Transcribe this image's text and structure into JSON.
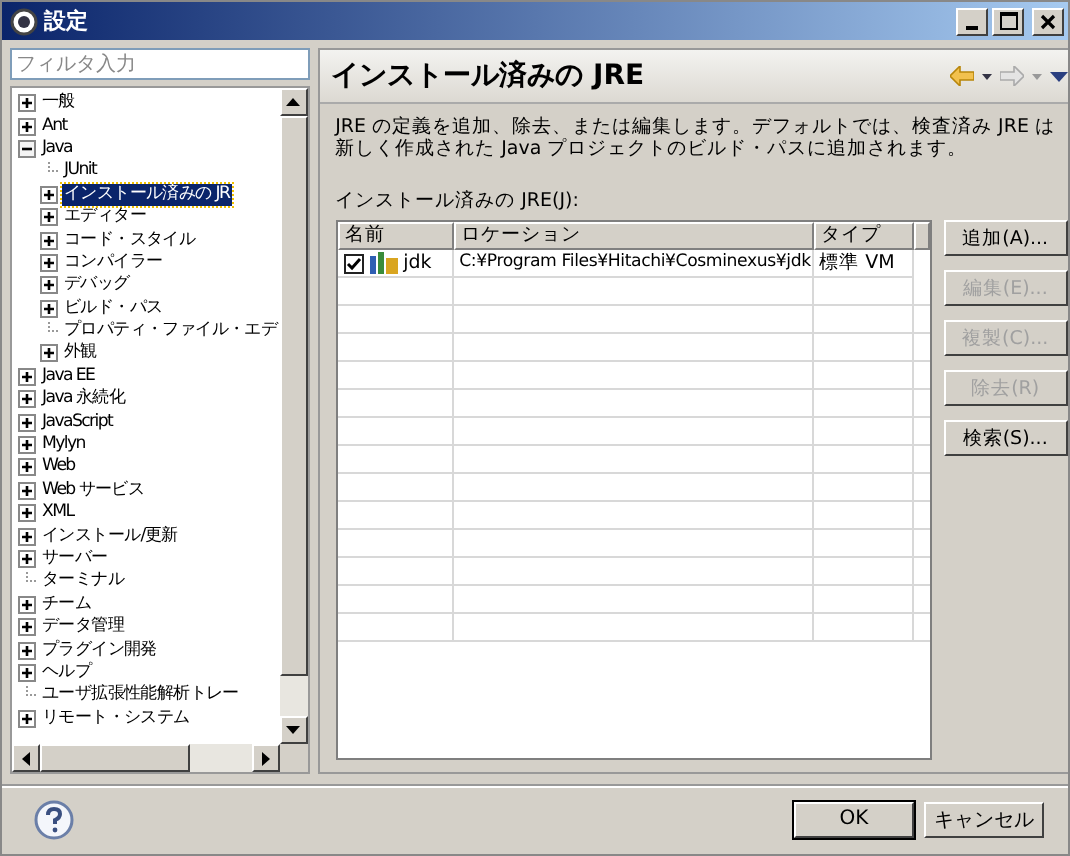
{
  "window": {
    "title": "設定"
  },
  "filter": {
    "placeholder": "フィルタ入力"
  },
  "tree": [
    {
      "label": "一般",
      "expanded": false,
      "expandable": true,
      "selected": false
    },
    {
      "label": "Ant",
      "expanded": false,
      "expandable": true,
      "selected": false
    },
    {
      "label": "Java",
      "expanded": true,
      "expandable": true,
      "selected": false,
      "children": [
        {
          "label": "JUnit",
          "expandable": false,
          "selected": false
        },
        {
          "label": "インストール済みの JR",
          "expanded": false,
          "expandable": true,
          "selected": true
        },
        {
          "label": "エディター",
          "expanded": false,
          "expandable": true,
          "selected": false
        },
        {
          "label": "コード・スタイル",
          "expanded": false,
          "expandable": true,
          "selected": false
        },
        {
          "label": "コンパイラー",
          "expanded": false,
          "expandable": true,
          "selected": false
        },
        {
          "label": "デバッグ",
          "expanded": false,
          "expandable": true,
          "selected": false
        },
        {
          "label": "ビルド・パス",
          "expanded": false,
          "expandable": true,
          "selected": false
        },
        {
          "label": "プロパティ・ファイル・エデ",
          "expandable": false,
          "selected": false
        },
        {
          "label": "外観",
          "expanded": false,
          "expandable": true,
          "selected": false
        }
      ]
    },
    {
      "label": "Java EE",
      "expanded": false,
      "expandable": true,
      "selected": false
    },
    {
      "label": "Java 永続化",
      "expanded": false,
      "expandable": true,
      "selected": false
    },
    {
      "label": "JavaScript",
      "expanded": false,
      "expandable": true,
      "selected": false
    },
    {
      "label": "Mylyn",
      "expanded": false,
      "expandable": true,
      "selected": false
    },
    {
      "label": "Web",
      "expanded": false,
      "expandable": true,
      "selected": false
    },
    {
      "label": "Web サービス",
      "expanded": false,
      "expandable": true,
      "selected": false
    },
    {
      "label": "XML",
      "expanded": false,
      "expandable": true,
      "selected": false
    },
    {
      "label": "インストール/更新",
      "expanded": false,
      "expandable": true,
      "selected": false
    },
    {
      "label": "サーバー",
      "expanded": false,
      "expandable": true,
      "selected": false
    },
    {
      "label": "ターミナル",
      "expandable": false,
      "selected": false
    },
    {
      "label": "チーム",
      "expanded": false,
      "expandable": true,
      "selected": false
    },
    {
      "label": "データ管理",
      "expanded": false,
      "expandable": true,
      "selected": false
    },
    {
      "label": "プラグイン開発",
      "expanded": false,
      "expandable": true,
      "selected": false
    },
    {
      "label": "ヘルプ",
      "expanded": false,
      "expandable": true,
      "selected": false
    },
    {
      "label": "ユーザ拡張性能解析トレー",
      "expandable": false,
      "selected": false
    },
    {
      "label": "リモート・システム",
      "expanded": false,
      "expandable": true,
      "selected": false
    }
  ],
  "page": {
    "title": "インストール済みの JRE",
    "description": "JRE の定義を追加、除去、または編集します。デフォルトでは、検査済み JRE は新しく作成された Java プロジェクトのビルド・パスに追加されます。",
    "list_label": "インストール済みの JRE(J):"
  },
  "table": {
    "columns": [
      "名前",
      "ロケーション",
      "タイプ"
    ],
    "rows": [
      {
        "checked": true,
        "name": "jdk",
        "location": "C:¥Program Files¥Hitachi¥Cosminexus¥jdk",
        "type": "標準 VM"
      }
    ]
  },
  "side_buttons": [
    {
      "label": "追加(A)...",
      "disabled": false
    },
    {
      "label": "編集(E)...",
      "disabled": true
    },
    {
      "label": "複製(C)...",
      "disabled": true
    },
    {
      "label": "除去(R)",
      "disabled": true
    },
    {
      "label": "検索(S)...",
      "disabled": false
    }
  ],
  "buttons": [
    "OK",
    "キャンセル"
  ]
}
